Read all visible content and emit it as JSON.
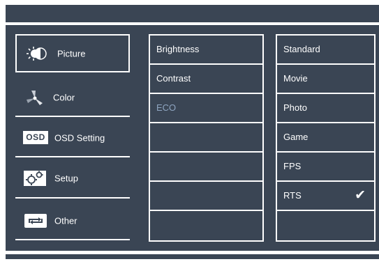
{
  "left_menu": {
    "items": [
      {
        "label": "Picture",
        "icon": "picture-icon",
        "selected": true
      },
      {
        "label": "Color",
        "icon": "color-icon",
        "selected": false
      },
      {
        "label": "OSD Setting",
        "icon": "osd-icon",
        "icon_text": "OSD",
        "selected": false
      },
      {
        "label": "Setup",
        "icon": "gears-icon",
        "selected": false
      },
      {
        "label": "Other",
        "icon": "other-icon",
        "selected": false
      }
    ]
  },
  "middle_column": {
    "items": [
      {
        "label": "Brightness",
        "enabled": true
      },
      {
        "label": "Contrast",
        "enabled": true
      },
      {
        "label": "ECO",
        "enabled": false
      },
      {
        "label": "",
        "enabled": false
      },
      {
        "label": "",
        "enabled": false
      },
      {
        "label": "",
        "enabled": false
      },
      {
        "label": "",
        "enabled": false
      }
    ]
  },
  "right_column": {
    "items": [
      {
        "label": "Standard",
        "checked": false
      },
      {
        "label": "Movie",
        "checked": false
      },
      {
        "label": "Photo",
        "checked": false
      },
      {
        "label": "Game",
        "checked": false
      },
      {
        "label": "FPS",
        "checked": false
      },
      {
        "label": "RTS",
        "checked": true
      },
      {
        "label": "",
        "checked": false
      }
    ],
    "checkmark": "✔"
  },
  "colors": {
    "background": "#3a4554",
    "foreground": "#ffffff",
    "disabled_text": "#8fa6c2"
  }
}
